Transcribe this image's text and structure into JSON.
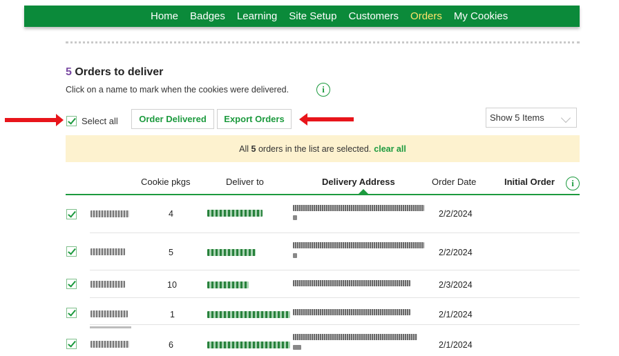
{
  "nav": {
    "items": [
      "Home",
      "Badges",
      "Learning",
      "Site Setup",
      "Customers",
      "Orders",
      "My Cookies"
    ],
    "active": "Orders"
  },
  "page": {
    "count": "5",
    "title": "Orders to deliver",
    "subtext": "Click on a name to mark when the cookies were delivered."
  },
  "toolbar": {
    "select_all_label": "Select all",
    "order_delivered_label": "Order Delivered",
    "export_orders_label": "Export Orders",
    "show_items_value": "Show 5 Items"
  },
  "banner": {
    "prefix": "All",
    "count": "5",
    "suffix": "orders in the list are selected.",
    "clear_label": "clear all"
  },
  "table": {
    "headers": [
      "Cookie pkgs",
      "Deliver to",
      "Delivery Address",
      "Order Date",
      "Initial Order"
    ],
    "rows": [
      {
        "pkgs": "4",
        "date": "2/2/2024",
        "selected": true
      },
      {
        "pkgs": "5",
        "date": "2/2/2024",
        "selected": true
      },
      {
        "pkgs": "10",
        "date": "2/3/2024",
        "selected": true
      },
      {
        "pkgs": "1",
        "date": "2/1/2024",
        "selected": true
      },
      {
        "pkgs": "6",
        "date": "2/1/2024",
        "selected": true
      }
    ]
  },
  "colors": {
    "nav_bg": "#0b8a3a",
    "nav_active": "#ffe36b",
    "accent_green": "#1c9a3e",
    "count_purple": "#7a4aa3",
    "banner_bg": "#fdf2cf",
    "annotation_arrow": "#e8151b"
  },
  "icons": [
    "info-icon",
    "checkbox-checked-icon",
    "chevron-down-icon",
    "sort-caret-icon",
    "red-arrow-annotation"
  ]
}
